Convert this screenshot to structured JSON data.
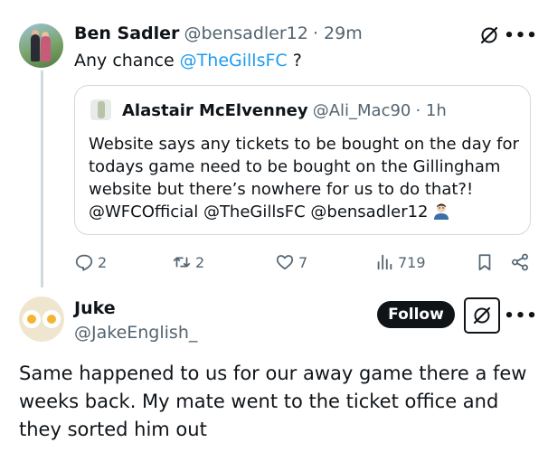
{
  "tweet": {
    "author_name": "Ben Sadler",
    "author_handle": "@bensadler12",
    "time": "· 29m",
    "text_prefix": "Any chance ",
    "mention": "@TheGillsFC",
    "text_suffix": " ?"
  },
  "quote": {
    "author_name": "Alastair McElvenney",
    "author_handle": "@Ali_Mac90",
    "time": "· 1h",
    "text": "Website says any tickets to be bought on the day for todays game need to be bought on the Gillingham website but there’s nowhere for us to do that?! @WFCOfficial @TheGillsFC @bensadler12"
  },
  "actions": {
    "replies": "2",
    "reposts": "2",
    "likes": "7",
    "views": "719"
  },
  "reply": {
    "author_name": "Juke",
    "author_handle": "@JakeEnglish_",
    "follow_label": "Follow",
    "text": "Same happened to us for our away game there a few weeks back. My mate went to the ticket office and they sorted him out"
  },
  "icons": {
    "more": "more-icon",
    "grok": "grok-icon",
    "reply": "reply-icon",
    "repost": "repost-icon",
    "like": "like-icon",
    "views": "views-icon",
    "bookmark": "bookmark-icon",
    "share": "share-icon"
  },
  "colors": {
    "link": "#1d9bf0",
    "secondary_text": "#536471",
    "border": "#cfd9de",
    "follow_bg": "#0f1419"
  }
}
